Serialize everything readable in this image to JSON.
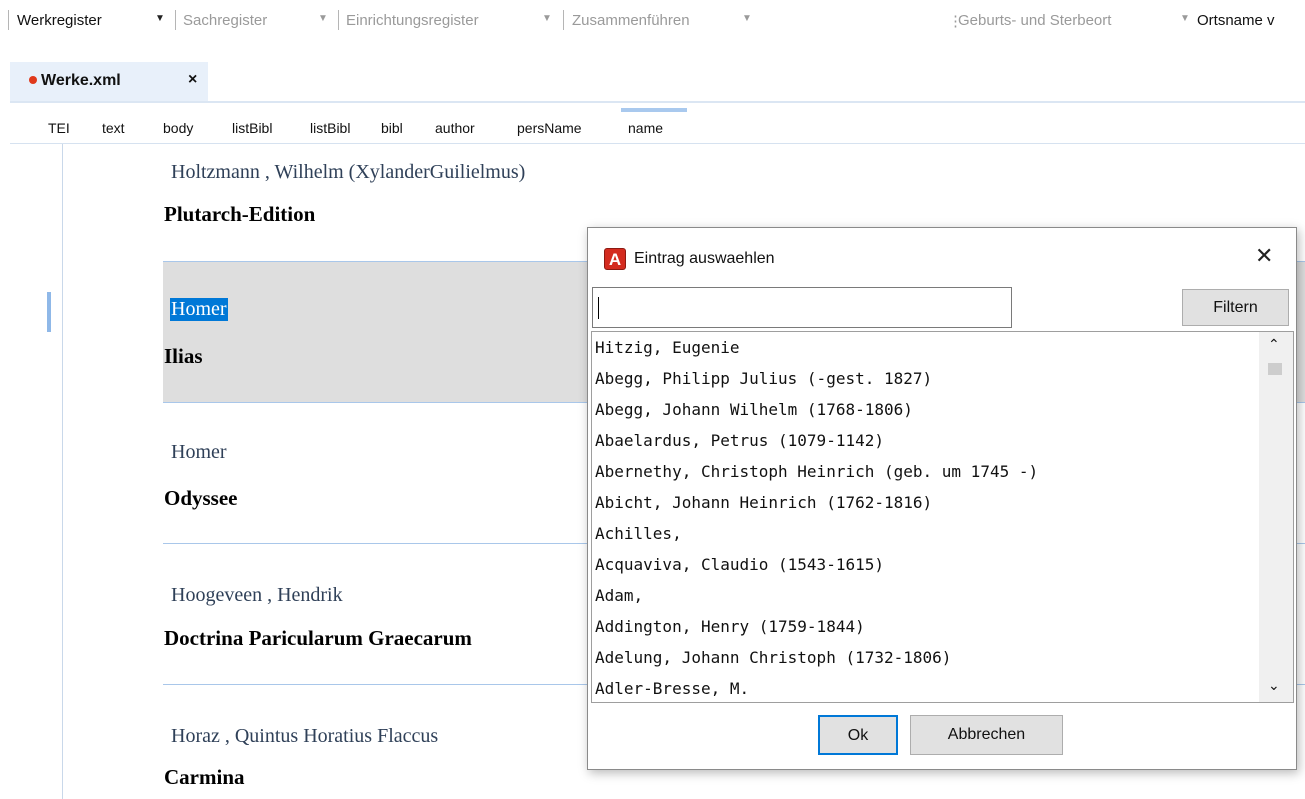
{
  "toolbar": {
    "items": [
      "Werkregister",
      "Sachregister",
      "Einrichtungsregister",
      "Zusammenführen",
      "Geburts- und Sterbeort",
      "Ortsname v"
    ]
  },
  "tab": {
    "label": "Werke.xml",
    "close": "×",
    "modified": true
  },
  "breadcrumb": [
    "TEI",
    "text",
    "body",
    "listBibl",
    "listBibl",
    "bibl",
    "author",
    "persName",
    "name"
  ],
  "entries": [
    {
      "author": "Holtzmann , Wilhelm (XylanderGuilielmus)",
      "title": "Plutarch-Edition"
    },
    {
      "author": "Homer",
      "title": "Ilias",
      "selected": true
    },
    {
      "author": "Homer",
      "title": "Odyssee"
    },
    {
      "author": "Hoogeveen , Hendrik",
      "title": "Doctrina Paricularum Graecarum"
    },
    {
      "author": "Horaz , Quintus Horatius Flaccus",
      "title": "Carmina"
    }
  ],
  "dialog": {
    "title": "Eintrag auswaehlen",
    "icon": "A",
    "close": "✕",
    "search_value": "",
    "filter_label": "Filtern",
    "items": [
      "Hitzig, Eugenie",
      "Abegg, Philipp Julius (-gest. 1827)",
      "Abegg, Johann Wilhelm (1768-1806)",
      "Abaelardus, Petrus (1079-1142)",
      "Abernethy, Christoph Heinrich (geb. um 1745 -)",
      "Abicht, Johann Heinrich (1762-1816)",
      "Achilles,",
      "Acquaviva, Claudio (1543-1615)",
      "Adam,",
      "Addington, Henry (1759-1844)",
      "Adelung, Johann Christoph (1732-1806)",
      "Adler-Bresse, M."
    ],
    "ok_label": "Ok",
    "cancel_label": "Abbrechen"
  },
  "colors": {
    "accent": "#0078d7",
    "tab_bg": "#e8f0fa",
    "modified_dot": "#e0391b",
    "author_text": "#2f4058"
  }
}
